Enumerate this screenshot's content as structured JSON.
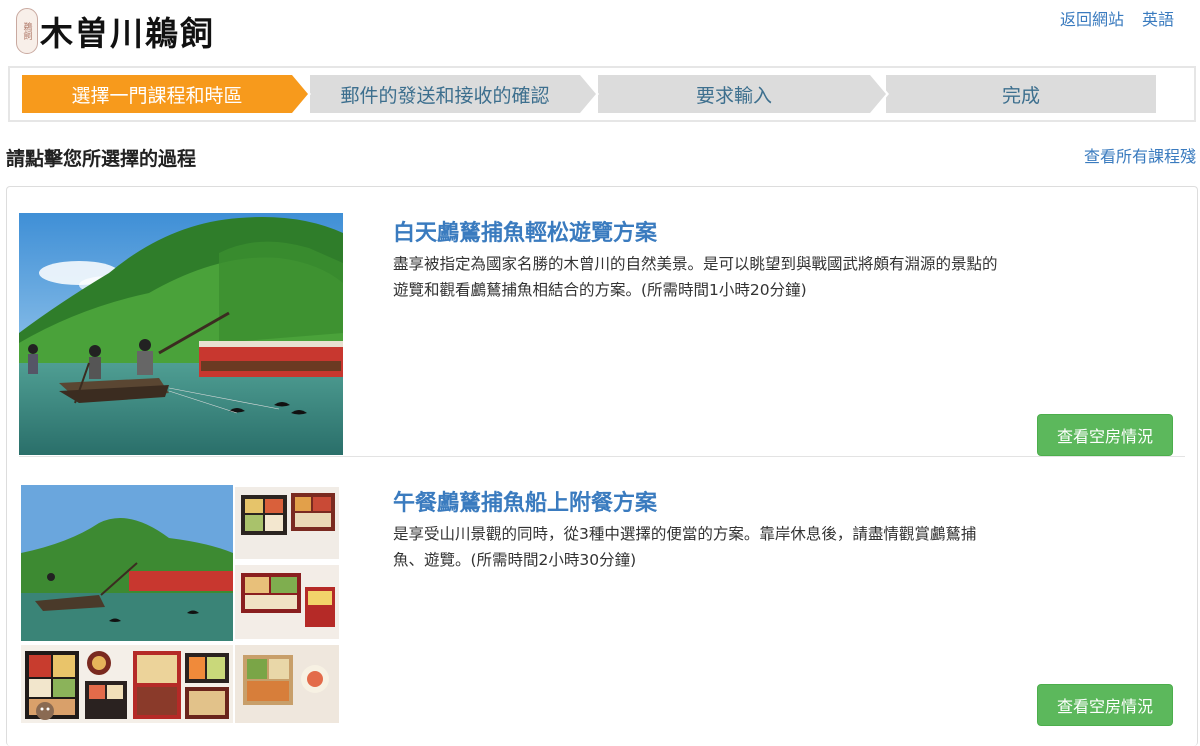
{
  "header": {
    "logo_text": "木曽川鵜飼",
    "seal_text": "鵜飼",
    "links": {
      "back": "返回網站",
      "english": "英語"
    }
  },
  "steps": [
    {
      "label": "選擇一門課程和時區",
      "active": true
    },
    {
      "label": "郵件的發送和接收的確認",
      "active": false
    },
    {
      "label": "要求輸入",
      "active": false
    },
    {
      "label": "完成",
      "active": false
    }
  ],
  "section": {
    "title": "請點擊您所選擇的過程",
    "view_all": "查看所有課程殘"
  },
  "courses": [
    {
      "title": "白天鸕鶿捕魚輕松遊覽方案",
      "description": "盡享被指定為國家名勝的木曾川的自然美景。是可以眺望到與戰國武將頗有淵源的景點的遊覽和觀看鸕鶿捕魚相結合的方案。(所需時間1小時20分鐘)",
      "button": "查看空房情況"
    },
    {
      "title": "午餐鸕鶿捕魚船上附餐方案",
      "description": "是享受山川景觀的同時，從3種中選擇的便當的方案。靠岸休息後，請盡情觀賞鸕鶿捕魚、遊覽。(所需時間2小時30分鐘)",
      "button": "查看空房情況"
    }
  ],
  "colors": {
    "accent": "#f79a1c",
    "link": "#3a7bbf",
    "button": "#5cb85c"
  }
}
